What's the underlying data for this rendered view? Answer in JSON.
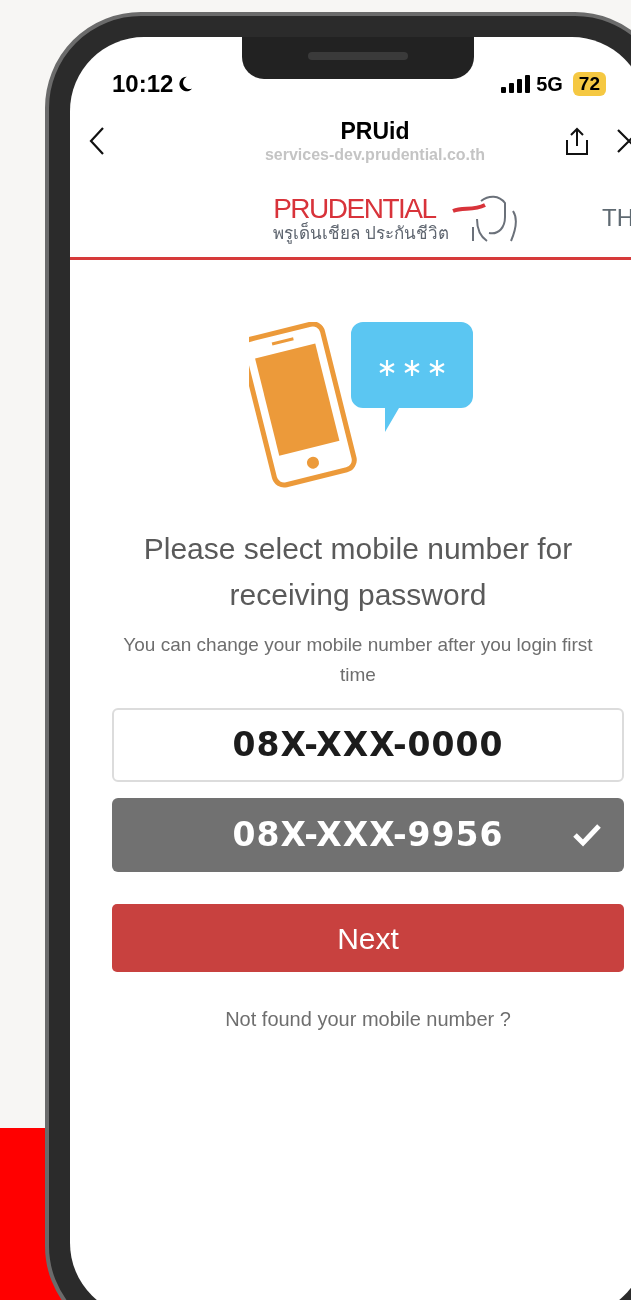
{
  "status_bar": {
    "time": "10:12",
    "network": "5G",
    "battery": "72"
  },
  "browser": {
    "title": "PRUid",
    "url": "services-dev.prudential.co.th"
  },
  "header": {
    "brand_name": "PRUDENTIAL",
    "brand_thai": "พรูเด็นเชียล ประกันชีวิต",
    "language": "TH"
  },
  "heading": "Please select mobile number for receiving password",
  "subtitle": "You can change your mobile number after you login first time",
  "numbers": [
    {
      "number": "08X-XXX-0000",
      "selected": false
    },
    {
      "number": "08X-XXX-9956",
      "selected": true
    }
  ],
  "next_button": "Next",
  "help_link": "Not found your mobile number ?"
}
